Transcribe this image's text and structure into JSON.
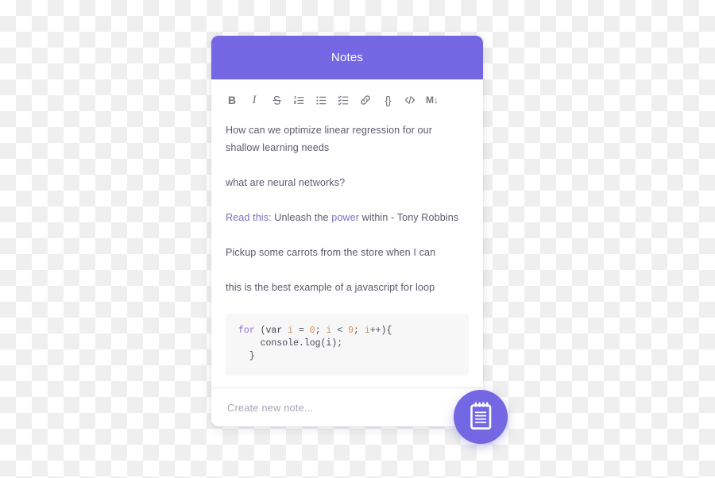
{
  "app": {
    "header_title": "Notes",
    "accent_color": "#7367e3",
    "body_text_color": "#595a6b",
    "link_color": "#7a6fc4",
    "card_background": "#ffffff",
    "code_block_background": "#f7f7f8"
  },
  "toolbar": {
    "items": [
      {
        "name": "bold-icon",
        "label": "B",
        "title": "Bold"
      },
      {
        "name": "italic-icon",
        "label": "I",
        "title": "Italic"
      },
      {
        "name": "strikethrough-icon",
        "label": "S",
        "title": "Strikethrough"
      },
      {
        "name": "ordered-list-icon",
        "label": "",
        "title": "Numbered list"
      },
      {
        "name": "bullet-list-icon",
        "label": "",
        "title": "Bulleted list"
      },
      {
        "name": "checklist-icon",
        "label": "",
        "title": "Checklist"
      },
      {
        "name": "link-icon",
        "label": "",
        "title": "Link"
      },
      {
        "name": "code-block-icon",
        "label": "{}",
        "title": "Code block"
      },
      {
        "name": "inline-code-icon",
        "label": "</>",
        "title": "Inline code"
      },
      {
        "name": "markdown-icon",
        "label": "M↓",
        "title": "Markdown"
      }
    ]
  },
  "notes": {
    "paragraph_1": "How can we optimize linear regression for our shallow learning needs",
    "paragraph_2": "what are neural networks?",
    "paragraph_3": {
      "prefix": "Read this:",
      "mid_1": " Unleash the ",
      "highlight": "power",
      "mid_2": " within - Tony Robbins"
    },
    "paragraph_4": "Pickup some carrots from the store when I can",
    "paragraph_5": "this is the best example of a javascript for loop",
    "code": {
      "line_1": {
        "kw": "for",
        "open": " (",
        "var_kw": "var",
        "sp1": " ",
        "ident_1": "i",
        "eq": " = ",
        "num_1": "0",
        "semi_1": "; ",
        "ident_2": "i",
        "lt": " < ",
        "num_2": "9",
        "semi_2": "; ",
        "ident_3": "i",
        "tail": "++){"
      },
      "line_2": "    console.log(i);",
      "line_3": "  }"
    }
  },
  "footer": {
    "new_note_placeholder": "Create new note...",
    "new_note_value": ""
  },
  "fab": {
    "icon": "notepad-icon",
    "label": "Create note"
  }
}
